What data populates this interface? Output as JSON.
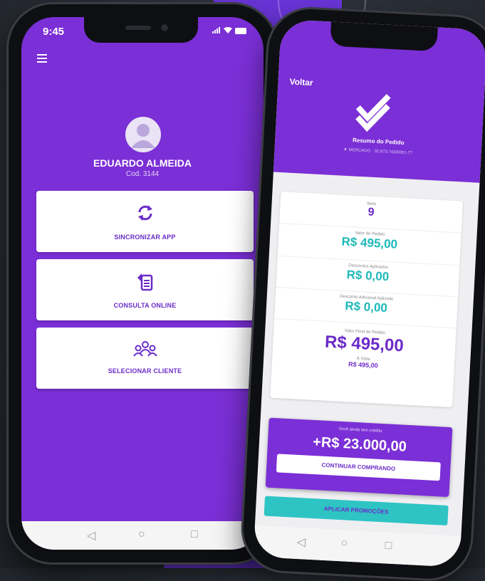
{
  "left_phone": {
    "status_time": "9:45",
    "profile": {
      "name": "EDUARDO ALMEIDA",
      "code": "Cod. 3144"
    },
    "cards": [
      {
        "label": "SINCRONIZAR APP",
        "icon": "sync-icon"
      },
      {
        "label": "CONSULTA ONLINE",
        "icon": "document-search-icon"
      },
      {
        "label": "SELECIONAR CLIENTE",
        "icon": "users-group-icon"
      }
    ],
    "nav": {
      "back": "◁",
      "home": "○",
      "recent": "□"
    }
  },
  "right_phone": {
    "back_label": "Voltar",
    "title": "Resumo do Pedido",
    "subtitle": "▼ MERCADO · 32.673.743/0001-77",
    "summary": [
      {
        "label": "Itens",
        "value": "9"
      },
      {
        "label": "Valor do Pedido",
        "value": "R$ 495,00"
      },
      {
        "label": "Descontos Aplicados",
        "value": "R$ 0,00"
      },
      {
        "label": "Desconto Adicional Aplicado",
        "value": "R$ 0,00"
      },
      {
        "label": "Valor Final do Pedido",
        "value": "R$ 495,00"
      }
    ],
    "payment": {
      "label": "À Vista",
      "value": "R$ 495,00"
    },
    "credit": {
      "note": "Você ainda tem crédito",
      "value": "+R$ 23.000,00"
    },
    "continue_label": "CONTINUAR COMPRANDO",
    "apply_label": "APLICAR PROMOÇÕES",
    "nav": {
      "back": "◁",
      "home": "○",
      "recent": "□"
    }
  },
  "colors": {
    "primary": "#7b2fd6",
    "accent": "#2ec4c4",
    "text_purple": "#6b2bc9"
  }
}
